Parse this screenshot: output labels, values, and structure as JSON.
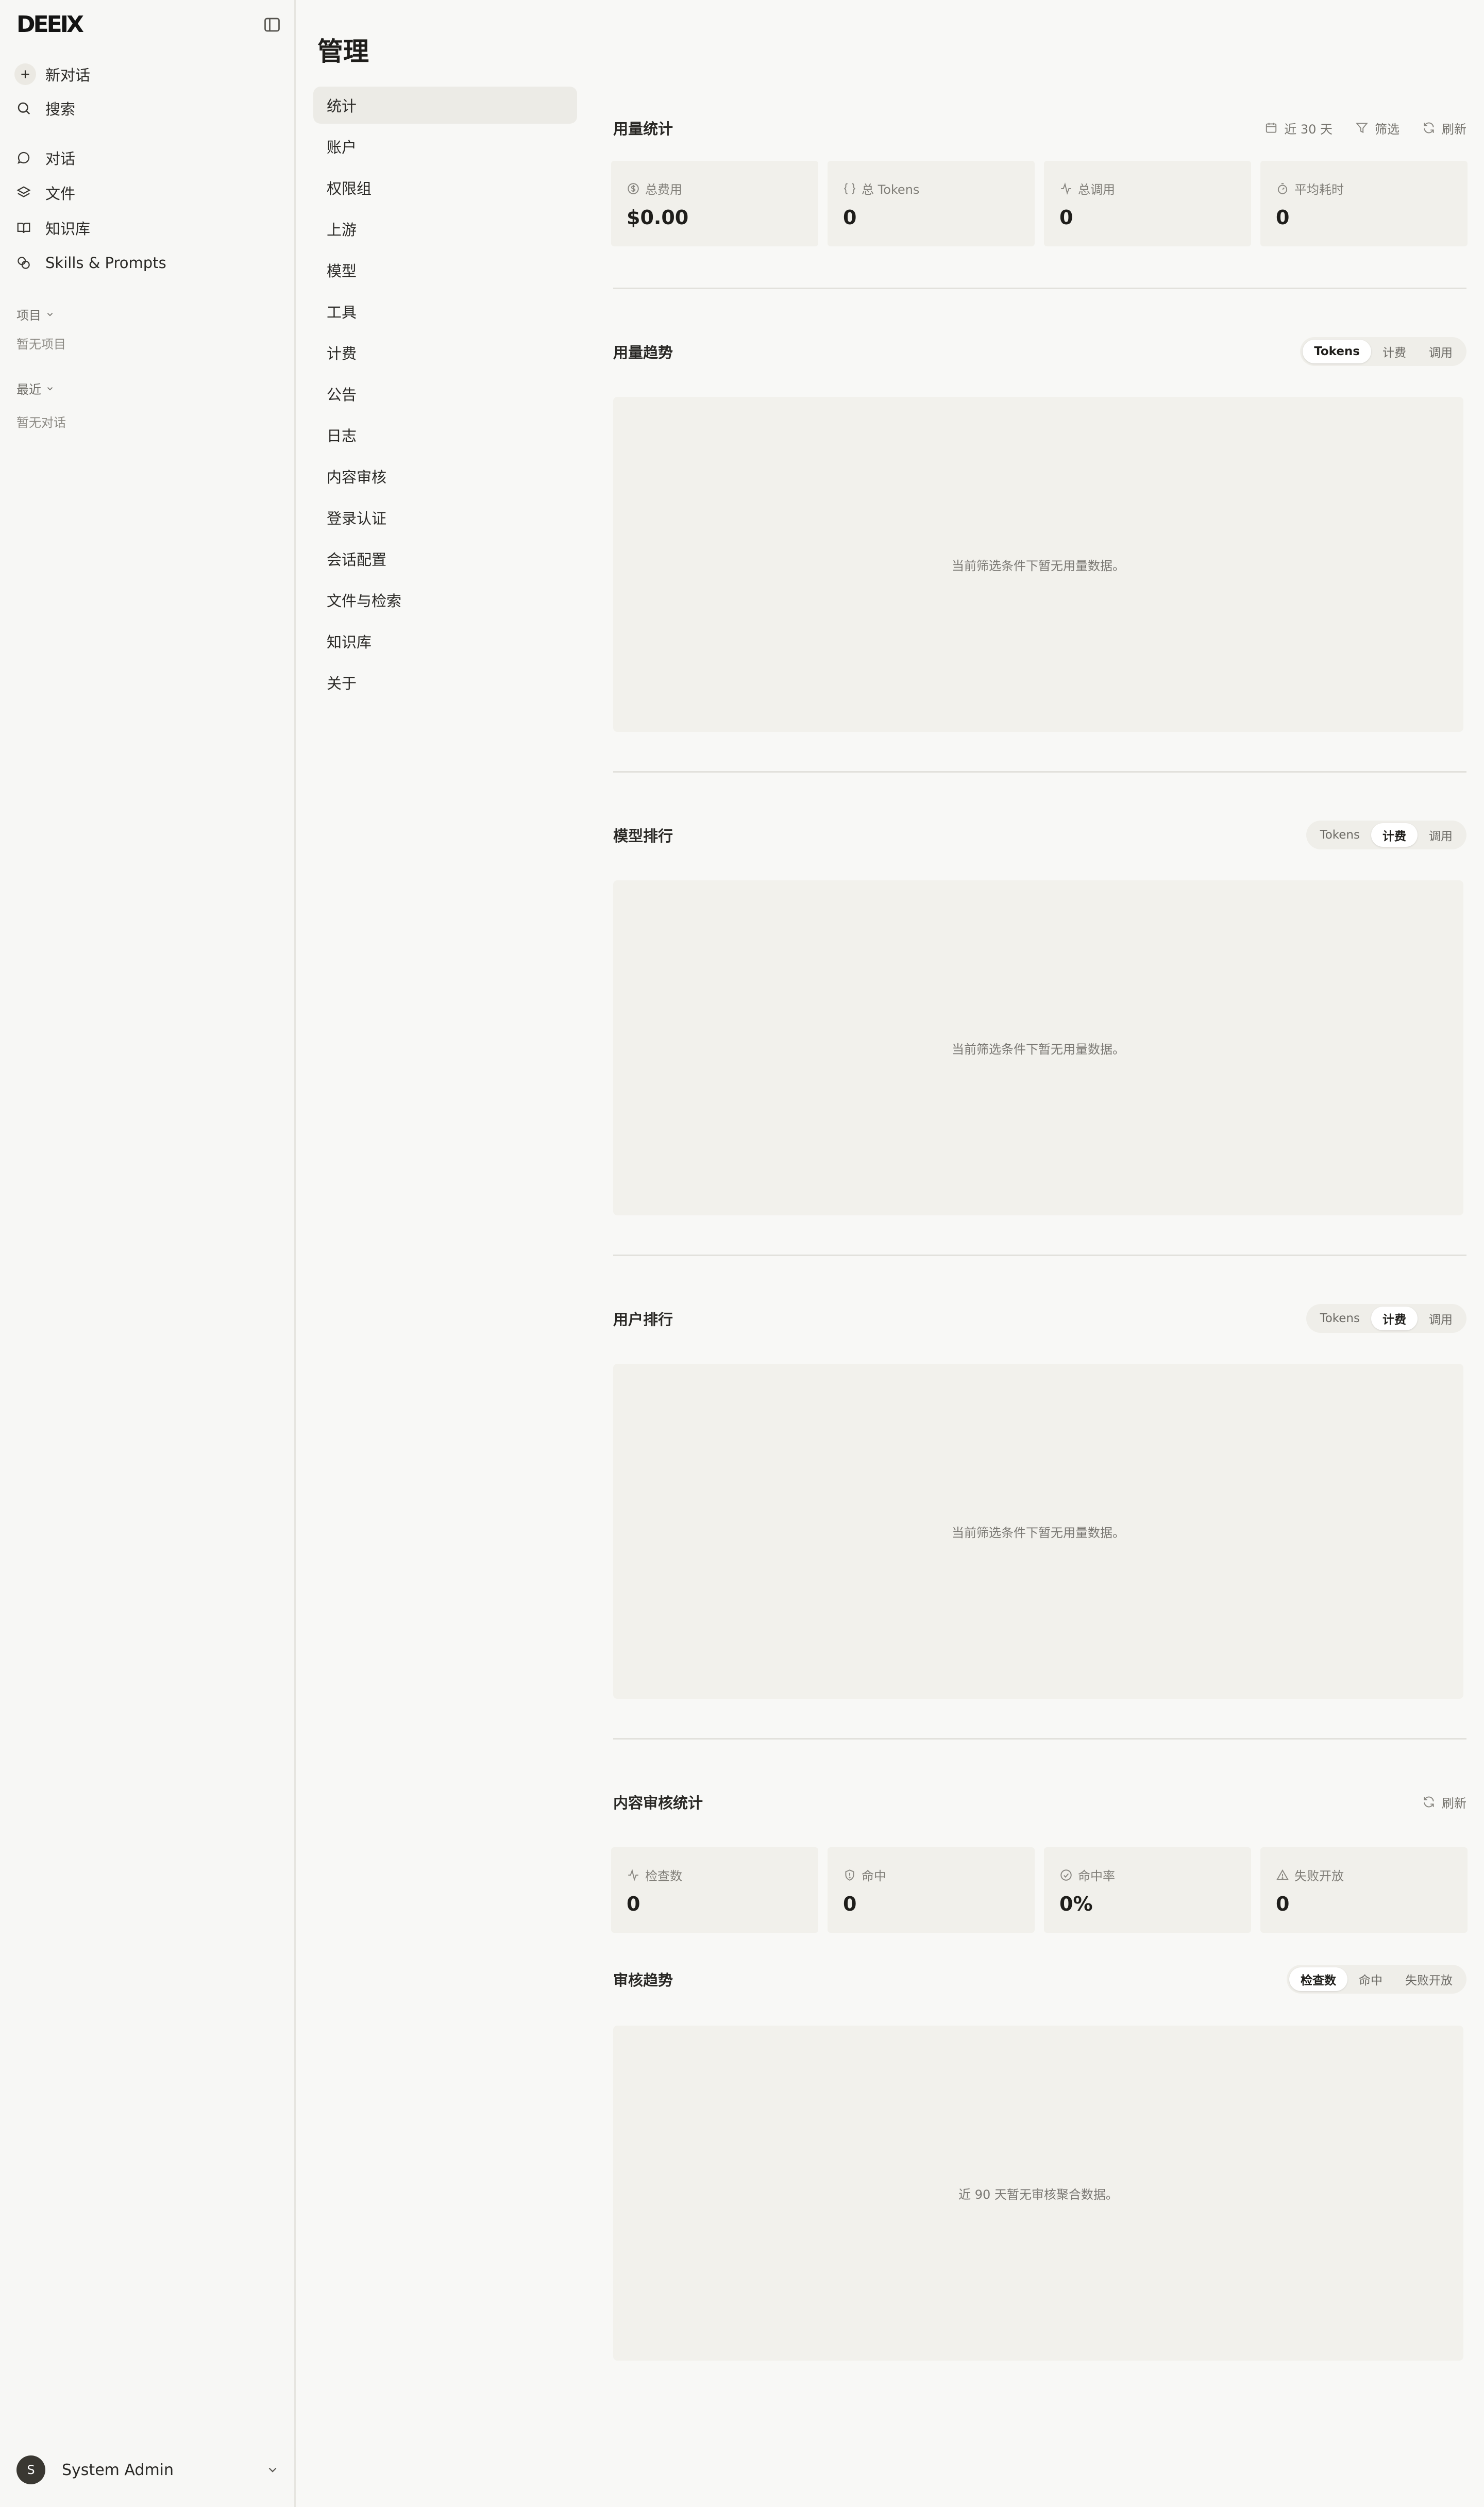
{
  "sidebar": {
    "logo": "DEEIX",
    "new_chat": "新对话",
    "search": "搜索",
    "nav": [
      "对话",
      "文件",
      "知识库",
      "Skills & Prompts"
    ],
    "projects_label": "项目",
    "projects_empty": "暂无项目",
    "recent_label": "最近",
    "recent_empty": "暂无对话",
    "user": {
      "initial": "S",
      "name": "System Admin"
    }
  },
  "page_title": "管理",
  "admin_nav": [
    "统计",
    "账户",
    "权限组",
    "上游",
    "模型",
    "工具",
    "计费",
    "公告",
    "日志",
    "内容审核",
    "登录认证",
    "会话配置",
    "文件与检索",
    "知识库",
    "关于"
  ],
  "usage": {
    "title": "用量统计",
    "range": "近 30 天",
    "filter": "筛选",
    "refresh": "刷新",
    "cards": [
      {
        "label": "总费用",
        "value": "$0.00"
      },
      {
        "label": "总 Tokens",
        "value": "0"
      },
      {
        "label": "总调用",
        "value": "0"
      },
      {
        "label": "平均耗时",
        "value": "0"
      }
    ]
  },
  "trend": {
    "title": "用量趋势",
    "options": [
      "Tokens",
      "计费",
      "调用"
    ],
    "empty": "当前筛选条件下暂无用量数据。"
  },
  "model_rank": {
    "title": "模型排行",
    "options": [
      "Tokens",
      "计费",
      "调用"
    ],
    "empty": "当前筛选条件下暂无用量数据。"
  },
  "user_rank": {
    "title": "用户排行",
    "options": [
      "Tokens",
      "计费",
      "调用"
    ],
    "empty": "当前筛选条件下暂无用量数据。"
  },
  "moderation": {
    "title": "内容审核统计",
    "refresh": "刷新",
    "cards": [
      {
        "label": "检查数",
        "value": "0"
      },
      {
        "label": "命中",
        "value": "0"
      },
      {
        "label": "命中率",
        "value": "0%"
      },
      {
        "label": "失败开放",
        "value": "0"
      }
    ]
  },
  "mod_trend": {
    "title": "审核趋势",
    "options": [
      "检查数",
      "命中",
      "失败开放"
    ],
    "empty": "近 90 天暂无审核聚合数据。"
  }
}
